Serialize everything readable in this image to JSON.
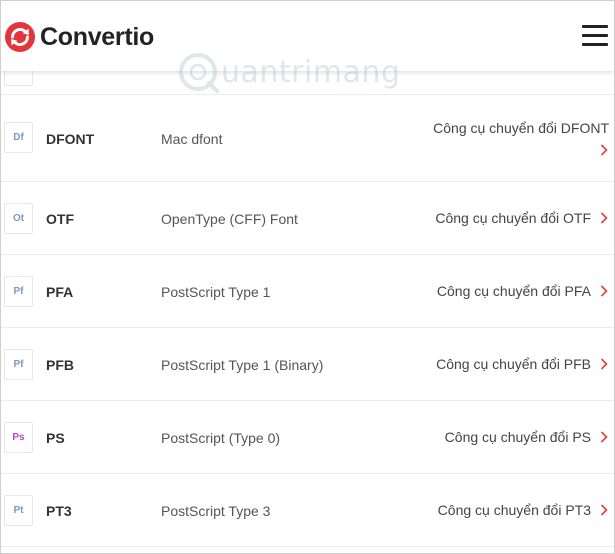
{
  "header": {
    "brand": "Convertio",
    "menu_icon": "hamburger-menu-icon"
  },
  "watermark": {
    "text": "uantrimang"
  },
  "colors": {
    "brand_red": "#e3353a",
    "chevron_red": "#e63b3b",
    "badge_blue": "#7a9cc0",
    "badge_purple": "#b44bd0"
  },
  "formats": [
    {
      "abbr": "Df",
      "ext": "DFONT",
      "desc": "Mac dfont",
      "link": "Công cụ chuyển đổi DFONT"
    },
    {
      "abbr": "Ot",
      "ext": "OTF",
      "desc": "OpenType (CFF) Font",
      "link": "Công cụ chuyển đổi OTF"
    },
    {
      "abbr": "Pf",
      "ext": "PFA",
      "desc": "PostScript Type 1",
      "link": "Công cụ chuyển đổi PFA"
    },
    {
      "abbr": "Pf",
      "ext": "PFB",
      "desc": "PostScript Type 1 (Binary)",
      "link": "Công cụ chuyển đổi PFB"
    },
    {
      "abbr": "Ps",
      "ext": "PS",
      "desc": "PostScript (Type 0)",
      "link": "Công cụ chuyển đổi PS"
    },
    {
      "abbr": "Pt",
      "ext": "PT3",
      "desc": "PostScript Type 3",
      "link": "Công cụ chuyển đổi PT3"
    }
  ]
}
